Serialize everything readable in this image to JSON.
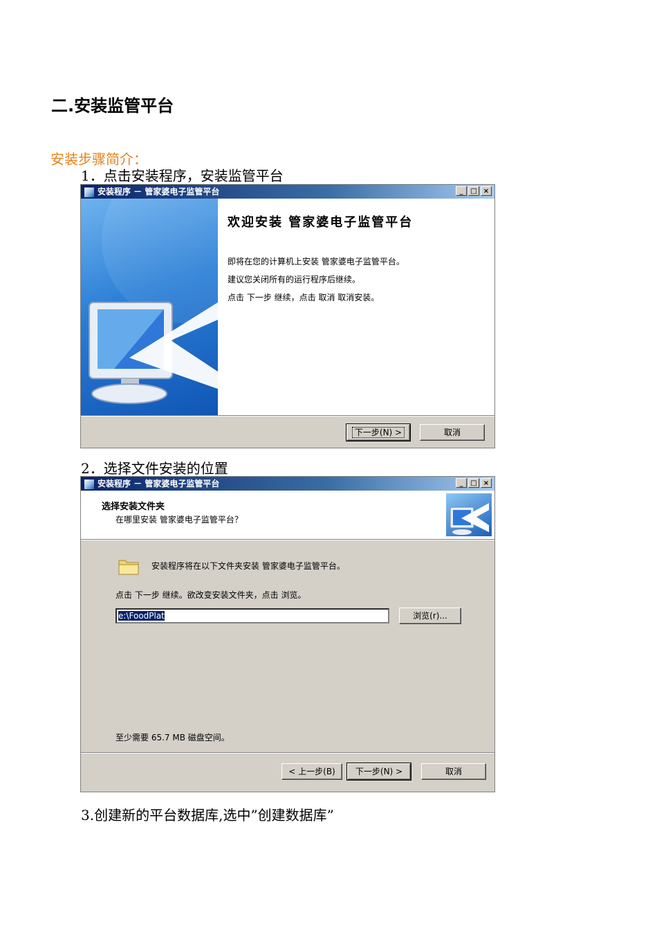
{
  "section_title": "二.安装监管平台",
  "intro_label": "安装步骤简介：",
  "steps": [
    "1．点击安装程序，安装监管平台",
    "2．选择文件安装的位置",
    "3.创建新的平台数据库,选中”创建数据库”"
  ],
  "window1": {
    "title": "安装程序 － 管家婆电子监管平台",
    "welcome_title": "欢迎安装 管家婆电子监管平台",
    "lines": [
      "即将在您的计算机上安装 管家婆电子监管平台。",
      "建议您关闭所有的运行程序后继续。",
      "点击 下一步 继续，点击 取消 取消安装。"
    ],
    "next_button": "下一步(N) >",
    "cancel_button": "取消"
  },
  "window2": {
    "title": "安装程序 － 管家婆电子监管平台",
    "header_title": "选择安装文件夹",
    "header_subtitle": "在哪里安装 管家婆电子监管平台？",
    "folder_text": "安装程序将在以下文件夹安装 管家婆电子监管平台。",
    "instruction": "点击 下一步 继续。欲改变安装文件夹，点击 浏览。",
    "path_value": "e:\\FoodPlat",
    "browse_button": "浏览(r)...",
    "space_required": "至少需要 65.7 MB 磁盘空间。",
    "back_button": "< 上一步(B)",
    "next_button": "下一步(N) >",
    "cancel_button": "取消"
  },
  "titlebar_buttons": [
    "_",
    "□",
    "×"
  ]
}
